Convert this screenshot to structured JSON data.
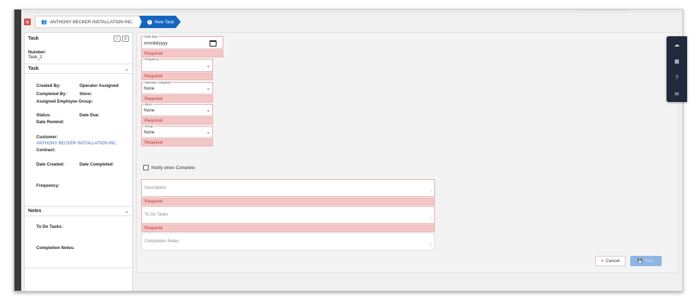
{
  "breadcrumb": {
    "customer": "ANTHONY BECKER INSTALLATION INC.",
    "current": "New Task"
  },
  "sidebar": {
    "title": "Task",
    "number_label": "Number:",
    "number_value": "Task_2",
    "task_section": "Task",
    "fields": {
      "created_by": "Created By:",
      "operator_assigned": "Operator Assigned:",
      "completed_by": "Completed By:",
      "store": "Store:",
      "assigned_group": "Assigned Employee Group:",
      "status": "Status:",
      "date_due": "Date Due:",
      "date_remind": "Date Remind:",
      "customer": "Customer:",
      "customer_value": "ANTHONY BECKER INSTALLATION INC.",
      "contract": "Contract:",
      "date_created": "Date Created:",
      "date_completed": "Date Completed:",
      "frequency": "Frequency:"
    },
    "notes_section": "Notes",
    "notes_fields": {
      "todo": "To Do Tasks:",
      "completion": "Completion Notes:"
    }
  },
  "form": {
    "date_due_label": "Date Due",
    "date_due_value": "mm/dd/yyyy",
    "frequency_label": "Frequency",
    "frequency_value": "",
    "operator_label": "Operator Assigned",
    "operator_value": "None",
    "store_label": "Store",
    "store_value": "None",
    "group_label": "Group",
    "group_value": "None",
    "required": "Required",
    "notify_label": "Notify when Complete",
    "description_placeholder": "Description",
    "todo_placeholder": "To Do Tasks",
    "completion_placeholder": "Completion Notes",
    "cancel_label": "Cancel",
    "save_label": "Save"
  },
  "rail_icons": [
    "cloud-icon",
    "grid-icon",
    "help-icon",
    "mail-icon"
  ]
}
